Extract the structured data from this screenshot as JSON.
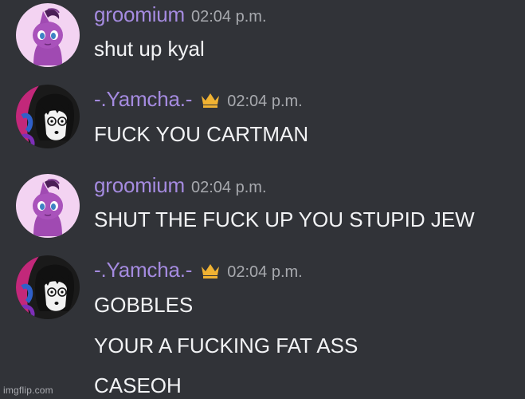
{
  "messages": [
    {
      "username": "groomium",
      "timestamp": "02:04 p.m.",
      "crown": false,
      "avatar_icon": "pony-avatar",
      "lines": [
        "shut up kyal"
      ]
    },
    {
      "username": "-.Yamcha.-",
      "timestamp": "02:04 p.m.",
      "crown": true,
      "avatar_icon": "anime-boy-avatar",
      "lines": [
        "FUCK YOU CARTMAN"
      ]
    },
    {
      "username": "groomium",
      "timestamp": "02:04 p.m.",
      "crown": false,
      "avatar_icon": "pony-avatar",
      "lines": [
        "SHUT THE FUCK UP YOU STUPID JEW"
      ]
    },
    {
      "username": "-.Yamcha.-",
      "timestamp": "02:04 p.m.",
      "crown": true,
      "avatar_icon": "anime-boy-avatar",
      "lines": [
        "GOBBLES",
        "YOUR A FUCKING FAT ASS",
        "CASEOH"
      ]
    }
  ],
  "watermark": "imgflip.com",
  "colors": {
    "background": "#313338",
    "username": "#a58be0",
    "message_text": "#f2f3f5",
    "timestamp": "#a7a9ae",
    "crown": "#f0b232"
  }
}
